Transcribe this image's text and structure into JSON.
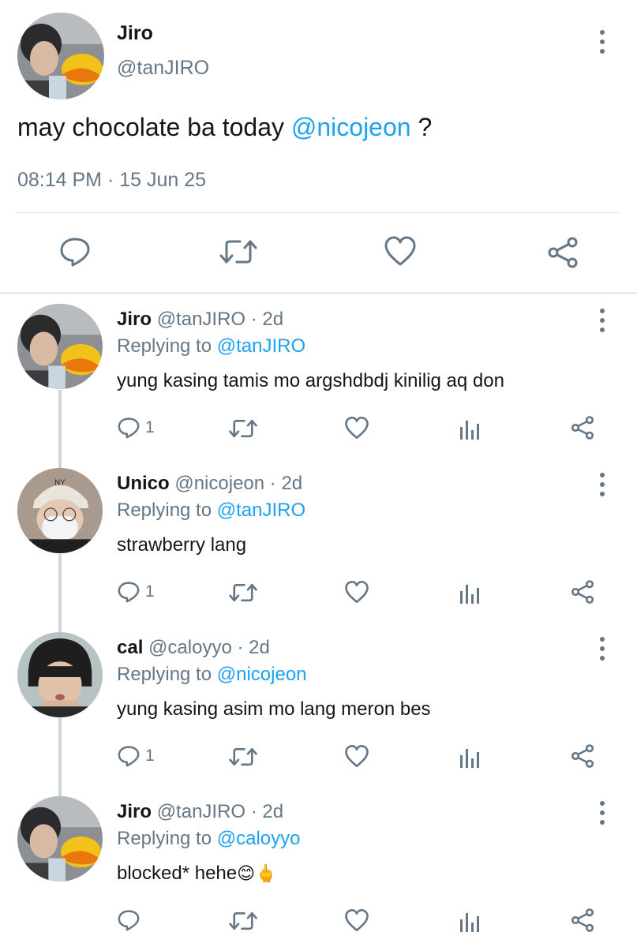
{
  "tweet": {
    "author_name": "Jiro",
    "author_handle": "@tanJIRO",
    "text_before": "may chocolate ba today ",
    "text_mention": "@nicojeon",
    "text_after": " ?",
    "timestamp": "08:14 PM · 15 Jun 25"
  },
  "icons": {
    "reply": "reply-icon",
    "retweet": "retweet-icon",
    "like": "like-icon",
    "analytics": "analytics-icon",
    "share": "share-icon",
    "more": "more-options-icon"
  },
  "colors": {
    "mention": "#1da1f2",
    "secondary_text": "#657786",
    "icon": "#657786"
  },
  "replies": [
    {
      "name": "Jiro",
      "handle": "@tanJIRO",
      "time": "· 2d",
      "replying_prefix": "Replying to ",
      "replying_to": "@tanJIRO",
      "text": "yung kasing tamis mo argshdbdj kinilig aq don",
      "reply_count": "1"
    },
    {
      "name": "Unico",
      "handle": "@nicojeon",
      "time": "· 2d",
      "replying_prefix": "Replying to ",
      "replying_to": "@tanJIRO",
      "text": "strawberry lang",
      "reply_count": "1"
    },
    {
      "name": "cal",
      "handle": "@caloyyo",
      "time": "· 2d",
      "replying_prefix": "Replying to ",
      "replying_to": "@nicojeon",
      "text": "yung kasing asim mo lang meron bes",
      "reply_count": "1"
    },
    {
      "name": "Jiro",
      "handle": "@tanJIRO",
      "time": "· 2d",
      "replying_prefix": "Replying to ",
      "replying_to": "@caloyyo",
      "text": "blocked* hehe",
      "emoji": "😊🖕",
      "reply_count": ""
    }
  ]
}
